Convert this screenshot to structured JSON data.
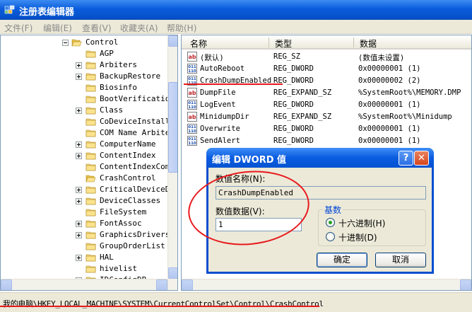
{
  "window": {
    "title": "注册表编辑器"
  },
  "menu": [
    {
      "id": "file",
      "label": "文件(F)"
    },
    {
      "id": "edit",
      "label": "编辑(E)"
    },
    {
      "id": "view",
      "label": "查看(V)"
    },
    {
      "id": "favorites",
      "label": "收藏夹(A)"
    },
    {
      "id": "help",
      "label": "帮助(H)"
    }
  ],
  "tree": [
    {
      "label": "Control",
      "expander": "minus",
      "open": true
    },
    {
      "label": "AGP",
      "expander": "none"
    },
    {
      "label": "Arbiters",
      "expander": "plus"
    },
    {
      "label": "BackupRestore",
      "expander": "plus"
    },
    {
      "label": "Biosinfo",
      "expander": "none"
    },
    {
      "label": "BootVerification",
      "expander": "none"
    },
    {
      "label": "Class",
      "expander": "plus"
    },
    {
      "label": "CoDeviceInstalle",
      "expander": "none"
    },
    {
      "label": "COM Name Arbiter",
      "expander": "none"
    },
    {
      "label": "ComputerName",
      "expander": "plus"
    },
    {
      "label": "ContentIndex",
      "expander": "plus"
    },
    {
      "label": "ContentIndexComm",
      "expander": "none"
    },
    {
      "label": "CrashControl",
      "expander": "none",
      "open": true,
      "selected": true
    },
    {
      "label": "CriticalDeviceDa",
      "expander": "plus"
    },
    {
      "label": "DeviceClasses",
      "expander": "plus"
    },
    {
      "label": "FileSystem",
      "expander": "none"
    },
    {
      "label": "FontAssoc",
      "expander": "plus"
    },
    {
      "label": "GraphicsDrivers",
      "expander": "plus"
    },
    {
      "label": "GroupOrderList",
      "expander": "none"
    },
    {
      "label": "HAL",
      "expander": "plus"
    },
    {
      "label": "hivelist",
      "expander": "none"
    },
    {
      "label": "IDConfigDB",
      "expander": "plus"
    }
  ],
  "list": {
    "columns": {
      "name": "名称",
      "type": "类型",
      "data": "数据"
    },
    "rows": [
      {
        "icon": "ab",
        "name": "(默认)",
        "type": "REG_SZ",
        "data": "(数值未设置)"
      },
      {
        "icon": "bin",
        "name": "AutoReboot",
        "type": "REG_DWORD",
        "data": "0x00000001 (1)"
      },
      {
        "icon": "bin",
        "name": "CrashDumpEnabled",
        "type": "REG_DWORD",
        "data": "0x00000002 (2)"
      },
      {
        "icon": "ab",
        "name": "DumpFile",
        "type": "REG_EXPAND_SZ",
        "data": "%SystemRoot%\\MEMORY.DMP"
      },
      {
        "icon": "bin",
        "name": "LogEvent",
        "type": "REG_DWORD",
        "data": "0x00000001 (1)"
      },
      {
        "icon": "ab",
        "name": "MinidumpDir",
        "type": "REG_EXPAND_SZ",
        "data": "%SystemRoot%\\Minidump"
      },
      {
        "icon": "bin",
        "name": "Overwrite",
        "type": "REG_DWORD",
        "data": "0x00000001 (1)"
      },
      {
        "icon": "bin",
        "name": "SendAlert",
        "type": "REG_DWORD",
        "data": "0x00000001 (1)"
      }
    ]
  },
  "dialog": {
    "title": "编辑 DWORD 值",
    "help": "?",
    "close": "✕",
    "name_label": "数值名称(N):",
    "name_value": "CrashDumpEnabled",
    "data_label": "数值数据(V):",
    "data_value": "1",
    "base_label": "基数",
    "hex_label": "十六进制(H)",
    "dec_label": "十进制(D)",
    "ok": "确定",
    "cancel": "取消"
  },
  "status": {
    "path": "我的电脑\\HKEY_LOCAL_MACHINE\\SYSTEM\\CurrentControlSet\\Control\\CrashControl"
  },
  "colors": {
    "accent": "#0a5cdc",
    "annotation": "#e8191d",
    "folder": "#f4d47a"
  }
}
